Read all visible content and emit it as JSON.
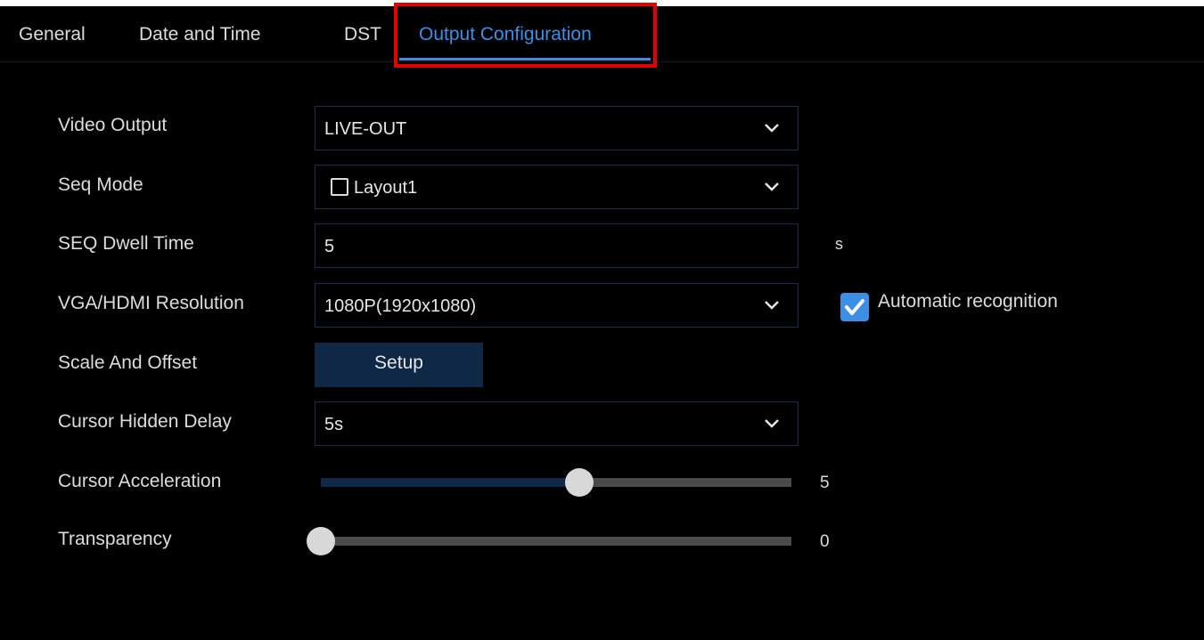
{
  "tabs": [
    {
      "label": "General",
      "active": false
    },
    {
      "label": "Date and Time",
      "active": false
    },
    {
      "label": "DST",
      "active": false
    },
    {
      "label": "Output Configuration",
      "active": true
    }
  ],
  "settings": {
    "video_output": {
      "label": "Video Output",
      "value": "LIVE-OUT"
    },
    "seq_mode": {
      "label": "Seq Mode",
      "value": "Layout1",
      "checked": false
    },
    "seq_dwell_time": {
      "label": "SEQ Dwell Time",
      "value": "5",
      "unit": "s"
    },
    "resolution": {
      "label": "VGA/HDMI Resolution",
      "value": "1080P(1920x1080)",
      "auto_label": "Automatic recognition",
      "auto_checked": true
    },
    "scale_offset": {
      "label": "Scale And Offset",
      "button_label": "Setup"
    },
    "cursor_hidden_delay": {
      "label": "Cursor Hidden Delay",
      "value": "5s"
    },
    "cursor_acceleration": {
      "label": "Cursor Acceleration",
      "value": "5",
      "fraction": 0.55
    },
    "transparency": {
      "label": "Transparency",
      "value": "0",
      "fraction": 0.0
    }
  },
  "icons": {
    "dropdown": "chevron-down-icon",
    "checkbox_checked": "check-icon"
  },
  "colors": {
    "accent": "#3d8fe6",
    "highlight_box": "#e40000",
    "button_bg": "#0f2846",
    "background": "#000000"
  }
}
